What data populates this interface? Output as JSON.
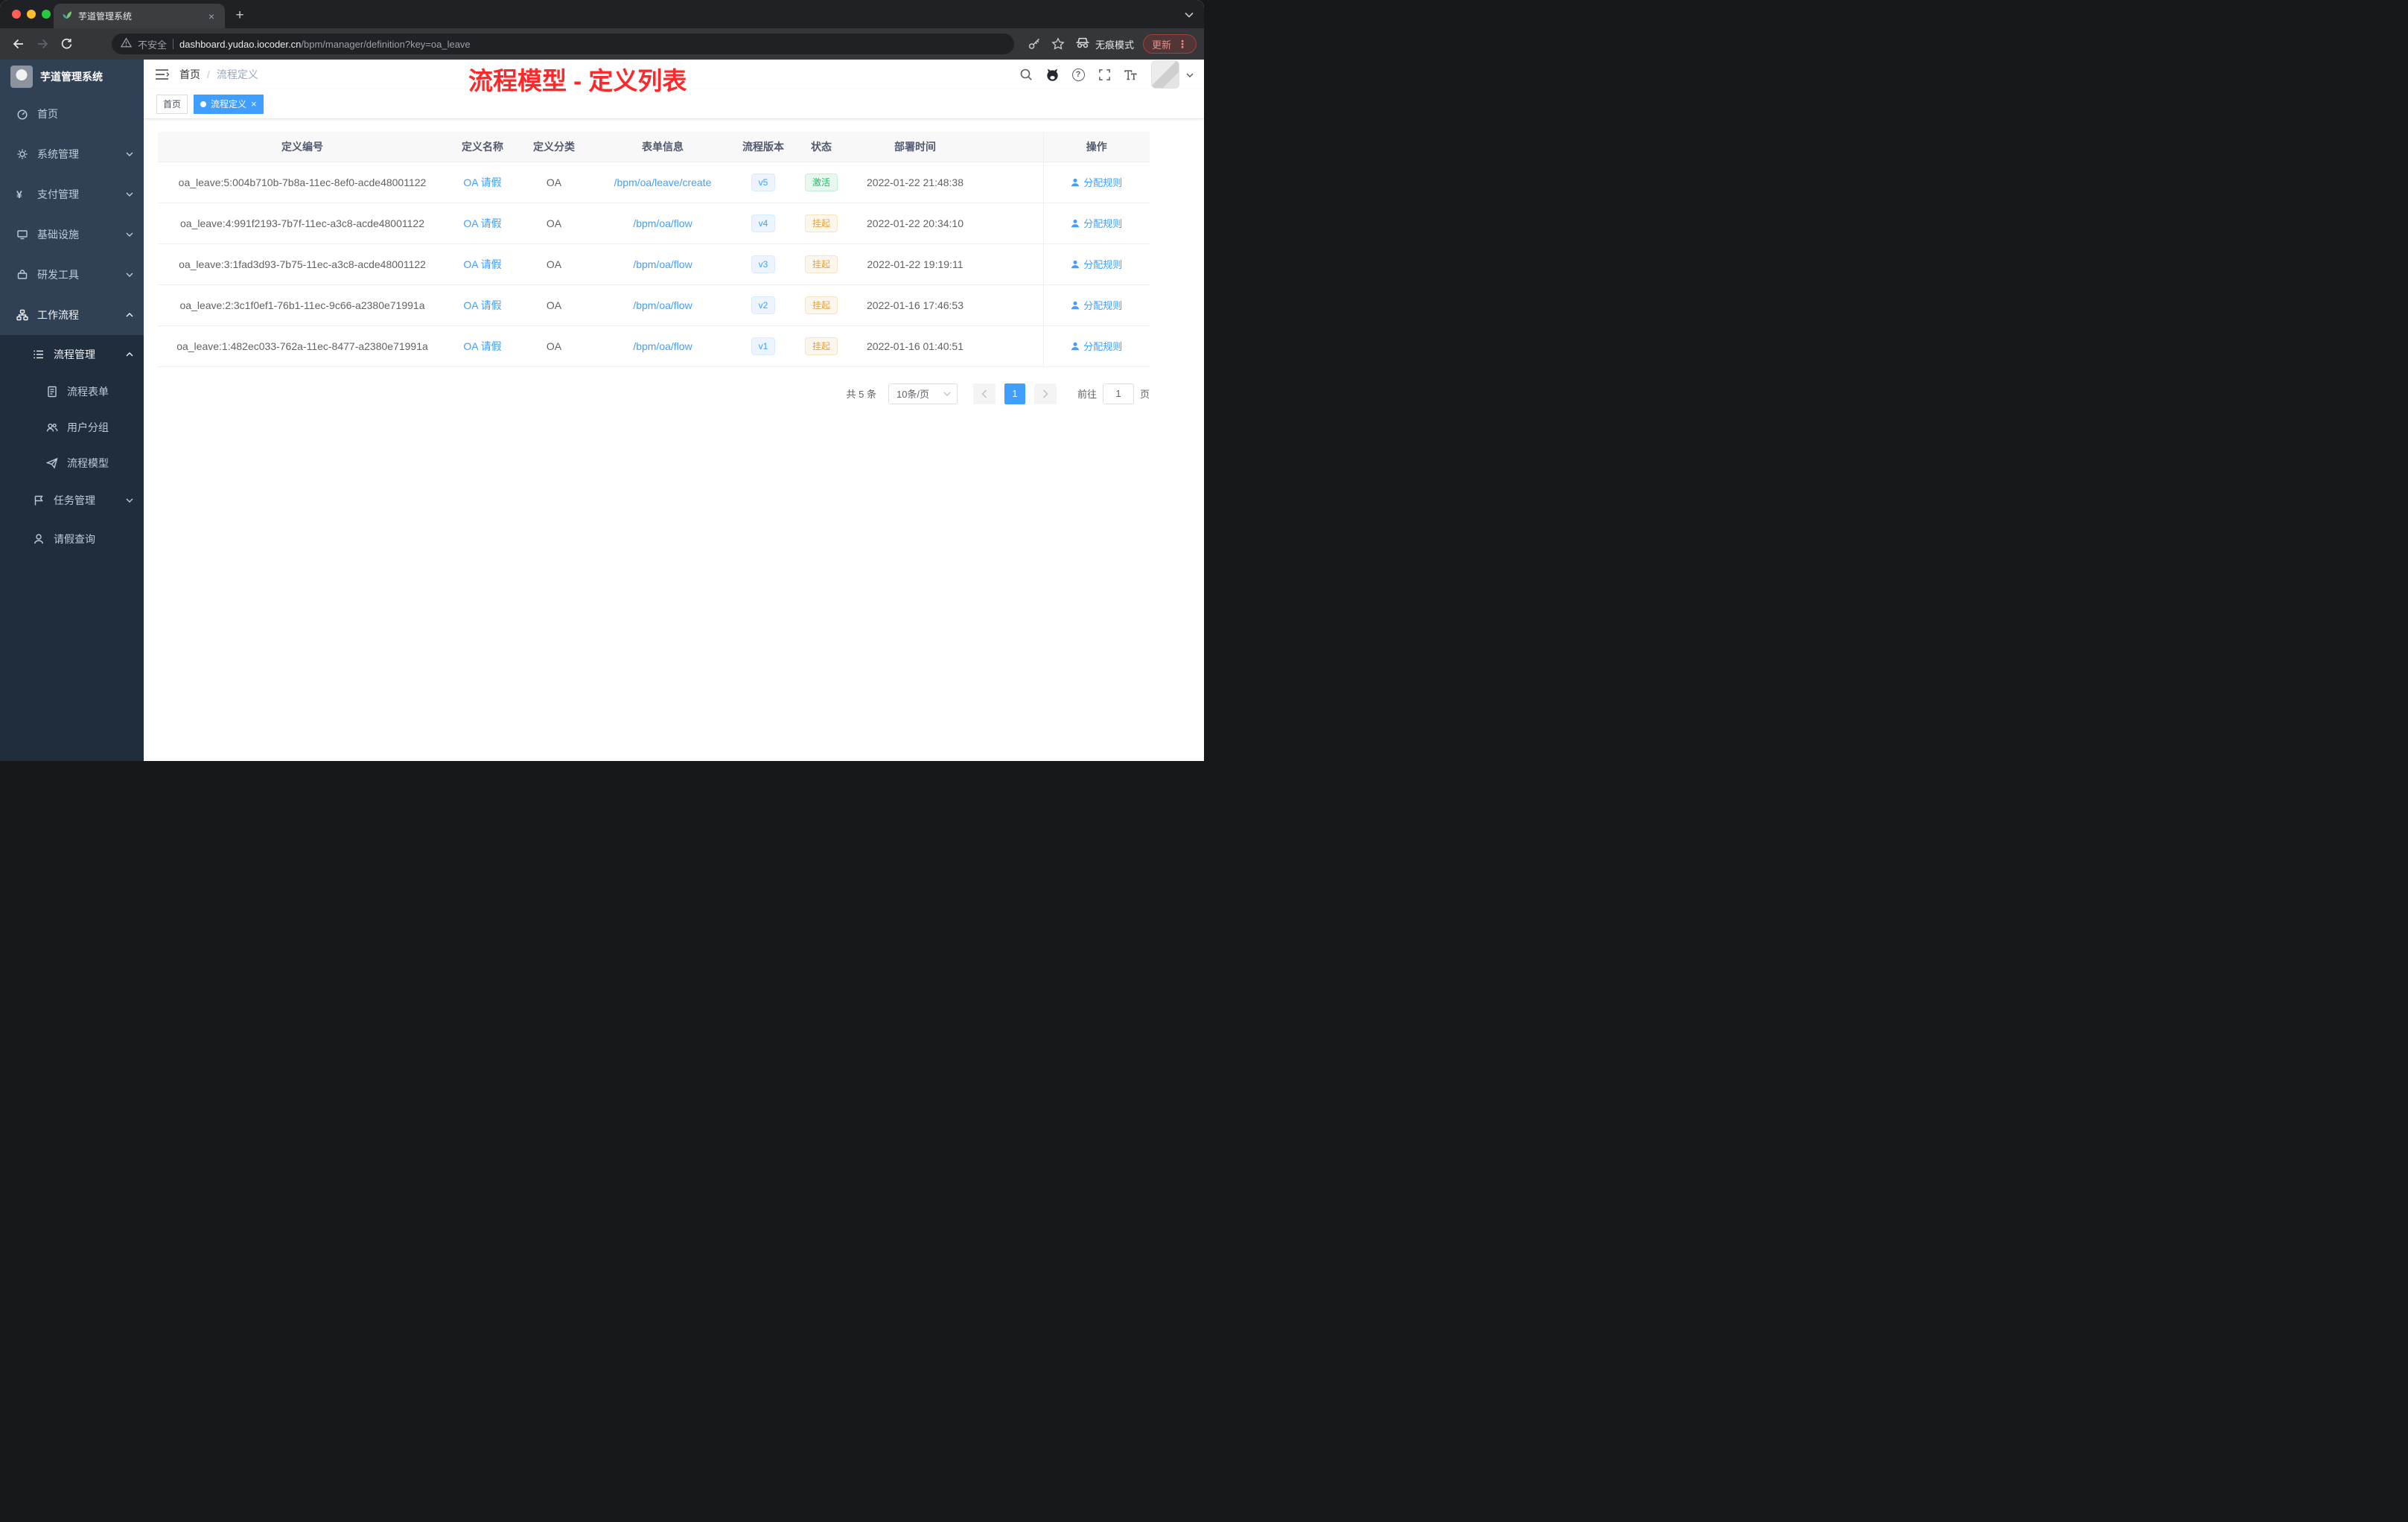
{
  "glyphs": {
    "close": "×",
    "plus": "+",
    "question": "?",
    "yen": "¥",
    "kebab": "⋮",
    "slash": "/"
  },
  "browser": {
    "tab_title": "芋道管理系统",
    "security_label": "不安全",
    "url_host": "dashboard.yudao.iocoder.cn",
    "url_path": "/bpm/manager/definition?key=oa_leave",
    "incognito_label": "无痕模式",
    "update_label": "更新"
  },
  "sidebar": {
    "app_title": "芋道管理系统",
    "items": [
      {
        "label": "首页"
      },
      {
        "label": "系统管理"
      },
      {
        "label": "支付管理"
      },
      {
        "label": "基础设施"
      },
      {
        "label": "研发工具"
      },
      {
        "label": "工作流程"
      },
      {
        "label": "流程管理"
      },
      {
        "label": "流程表单"
      },
      {
        "label": "用户分组"
      },
      {
        "label": "流程模型"
      },
      {
        "label": "任务管理"
      },
      {
        "label": "请假查询"
      }
    ]
  },
  "header": {
    "breadcrumb_home": "首页",
    "breadcrumb_current": "流程定义",
    "annotation": "流程模型 - 定义列表"
  },
  "tags": {
    "items": [
      {
        "label": "首页",
        "active": false
      },
      {
        "label": "流程定义",
        "active": true
      }
    ]
  },
  "table": {
    "columns": [
      "定义编号",
      "定义名称",
      "定义分类",
      "表单信息",
      "流程版本",
      "状态",
      "部署时间",
      "操作"
    ],
    "rows": [
      {
        "id": "oa_leave:5:004b710b-7b8a-11ec-8ef0-acde48001122",
        "name": "OA 请假",
        "category": "OA",
        "form": "/bpm/oa/leave/create",
        "version": "v5",
        "status": "激活",
        "status_type": "success",
        "time": "2022-01-22 21:48:38",
        "action": "分配规则"
      },
      {
        "id": "oa_leave:4:991f2193-7b7f-11ec-a3c8-acde48001122",
        "name": "OA 请假",
        "category": "OA",
        "form": "/bpm/oa/flow",
        "version": "v4",
        "status": "挂起",
        "status_type": "warning",
        "time": "2022-01-22 20:34:10",
        "action": "分配规则"
      },
      {
        "id": "oa_leave:3:1fad3d93-7b75-11ec-a3c8-acde48001122",
        "name": "OA 请假",
        "category": "OA",
        "form": "/bpm/oa/flow",
        "version": "v3",
        "status": "挂起",
        "status_type": "warning",
        "time": "2022-01-22 19:19:11",
        "action": "分配规则"
      },
      {
        "id": "oa_leave:2:3c1f0ef1-76b1-11ec-9c66-a2380e71991a",
        "name": "OA 请假",
        "category": "OA",
        "form": "/bpm/oa/flow",
        "version": "v2",
        "status": "挂起",
        "status_type": "warning",
        "time": "2022-01-16 17:46:53",
        "action": "分配规则"
      },
      {
        "id": "oa_leave:1:482ec033-762a-11ec-8477-a2380e71991a",
        "name": "OA 请假",
        "category": "OA",
        "form": "/bpm/oa/flow",
        "version": "v1",
        "status": "挂起",
        "status_type": "warning",
        "time": "2022-01-16 01:40:51",
        "action": "分配规则"
      }
    ]
  },
  "pagination": {
    "total": "共 5 条",
    "page_size": "10条/页",
    "page": "1",
    "goto_label": "前往",
    "goto_value": "1",
    "goto_unit": "页"
  }
}
